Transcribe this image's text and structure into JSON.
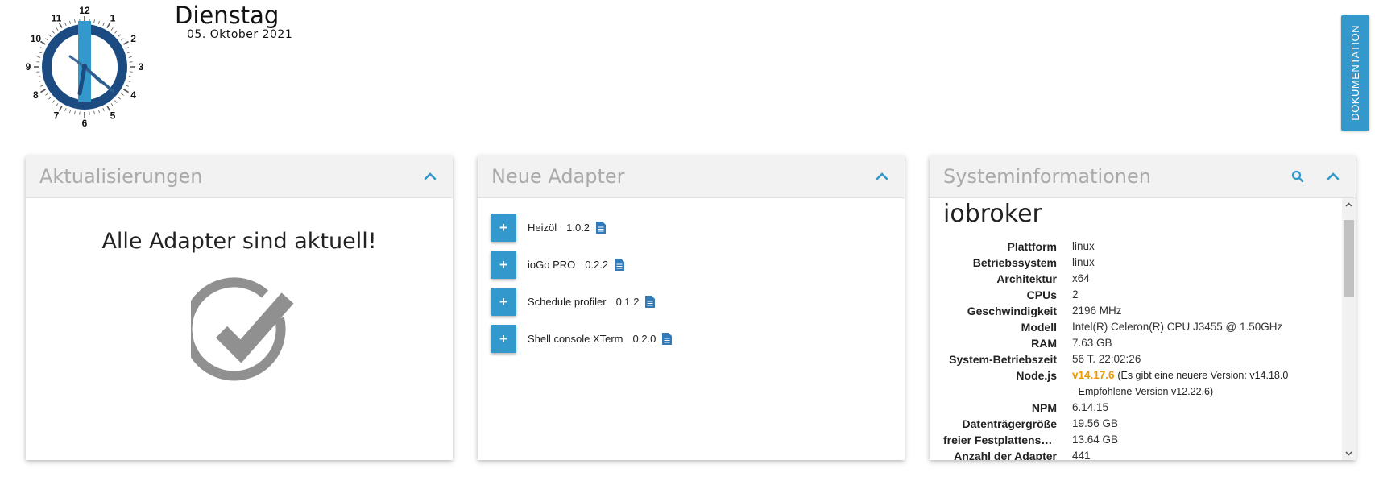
{
  "header": {
    "day": "Dienstag",
    "date": "05. Oktober 2021",
    "clock_numbers": [
      "12",
      "1",
      "2",
      "3",
      "4",
      "5",
      "6",
      "7",
      "8",
      "9",
      "10",
      "11"
    ],
    "doc_tab": "DOKUMENTATION"
  },
  "colors": {
    "accent": "#3399cc",
    "clock_ring": "#1c4b82",
    "node_warning": "#ee9900"
  },
  "updates": {
    "title": "Aktualisierungen",
    "message": "Alle Adapter sind aktuell!",
    "collapse_icon": "chevron-up-icon",
    "status_icon": "check-circle-icon"
  },
  "new_adapters": {
    "title": "Neue Adapter",
    "add_label": "+",
    "items": [
      {
        "name": "Heizöl",
        "version": "1.0.2"
      },
      {
        "name": "ioGo PRO",
        "version": "0.2.2"
      },
      {
        "name": "Schedule profiler",
        "version": "0.1.2"
      },
      {
        "name": "Shell console XTerm",
        "version": "0.2.0"
      }
    ]
  },
  "system": {
    "title": "Systeminformationen",
    "host": "iobroker",
    "rows": [
      {
        "key": "Plattform",
        "value": "linux"
      },
      {
        "key": "Betriebssystem",
        "value": "linux"
      },
      {
        "key": "Architektur",
        "value": "x64"
      },
      {
        "key": "CPUs",
        "value": "2"
      },
      {
        "key": "Geschwindigkeit",
        "value": "2196 MHz"
      },
      {
        "key": "Modell",
        "value": "Intel(R) Celeron(R) CPU J3455 @ 1.50GHz"
      },
      {
        "key": "RAM",
        "value": "7.63 GB"
      },
      {
        "key": "System-Betriebszeit",
        "value": "56 T. 22:02:26"
      }
    ],
    "node": {
      "key": "Node.js",
      "version": "v14.17.6",
      "note_line1": "(Es gibt eine neuere Version: v14.18.0",
      "note_line2": "- Empfohlene Version v12.22.6)"
    },
    "rows_after": [
      {
        "key": "NPM",
        "value": "6.14.15"
      },
      {
        "key": "Datenträgergröße",
        "value": "19.56 GB"
      },
      {
        "key": "freier Festplattenspeicher",
        "value": "13.64 GB"
      },
      {
        "key": "Anzahl der Adapter",
        "value": "441"
      }
    ]
  }
}
